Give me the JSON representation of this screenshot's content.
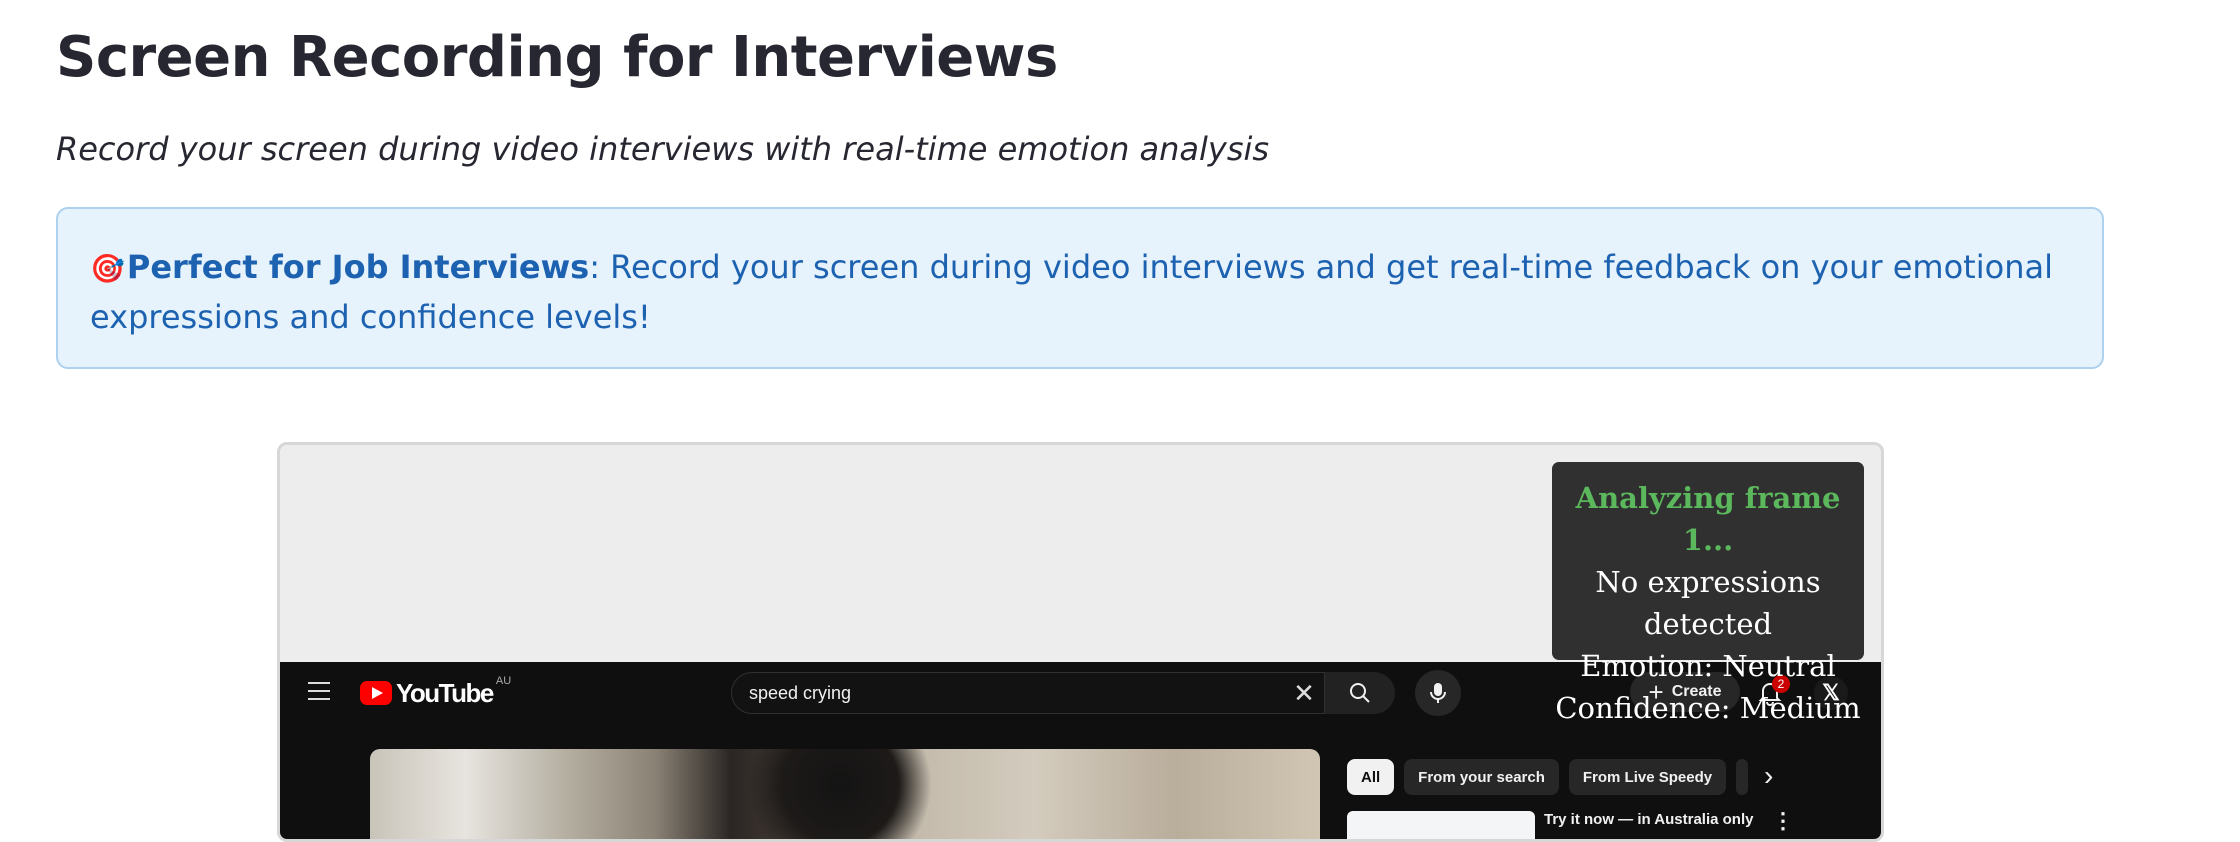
{
  "page": {
    "title": "Screen Recording for Interviews",
    "subtitle": "Record your screen during video interviews with real-time emotion analysis"
  },
  "info_box": {
    "icon": "target-icon",
    "icon_glyph": "🎯",
    "bold_text": "Perfect for Job Interviews",
    "text": ": Record your screen during video interviews and get real-time feedback on your emotional expressions and confidence levels!"
  },
  "overlay": {
    "status": "Analyzing frame 1...",
    "expressions": "No expressions detected",
    "emotion": "Emotion: Neutral",
    "confidence": "Confidence: Medium"
  },
  "youtube": {
    "logo_text": "YouTube",
    "region": "AU",
    "search_value": "speed crying",
    "create_label": "Create",
    "notification_count": "2",
    "chips": [
      {
        "label": "All",
        "active": true
      },
      {
        "label": "From your search",
        "active": false
      },
      {
        "label": "From Live Speedy",
        "active": false
      }
    ],
    "side_video_title": "Try it now — in Australia only"
  },
  "colors": {
    "info_bg": "#e6f2fc",
    "info_text": "#1c62b0",
    "overlay_bg": "#303030",
    "analyzing_green": "#5cb85c",
    "yt_bg": "#0f0f0f",
    "yt_red": "#ff0000"
  }
}
